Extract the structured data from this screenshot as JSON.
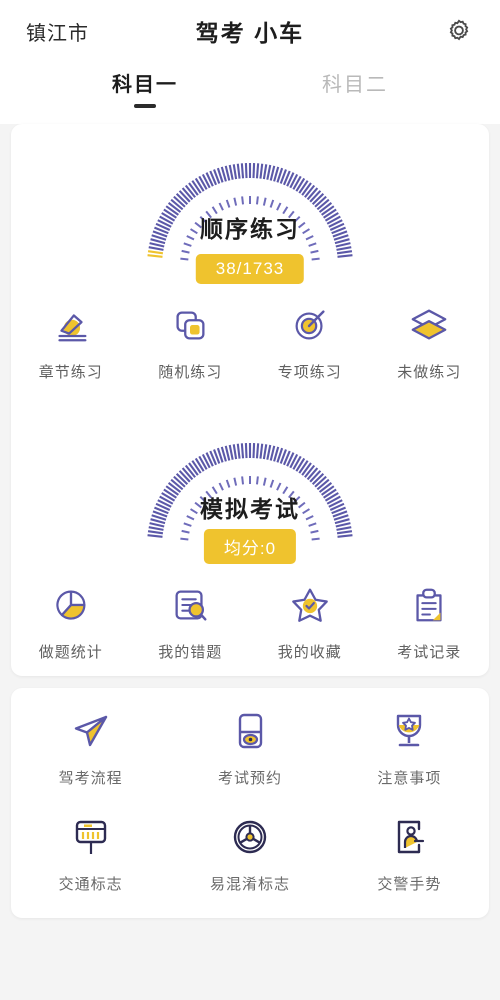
{
  "header": {
    "city": "镇江市",
    "title": "驾考 小车",
    "settings_icon": "gear-icon"
  },
  "tabs": [
    {
      "label": "科目一",
      "active": true
    },
    {
      "label": "科目二",
      "active": false
    }
  ],
  "colors": {
    "purple": "#5b58a8",
    "purple_light": "#6f6cba",
    "yellow": "#efc32e",
    "navy": "#2d2b52",
    "page_bg": "#f4f4f4",
    "card_bg": "#ffffff",
    "label": "#606060",
    "tab_inactive": "#b9b9b9"
  },
  "practice": {
    "gauge": {
      "title": "顺序练习",
      "badge": "38/1733",
      "done": 38,
      "total": 1733
    },
    "items": [
      {
        "label": "章节练习",
        "icon": "pencil-edit-icon"
      },
      {
        "label": "随机练习",
        "icon": "copy-squares-icon"
      },
      {
        "label": "专项练习",
        "icon": "target-icon"
      },
      {
        "label": "未做练习",
        "icon": "layers-stack-icon"
      }
    ]
  },
  "exam": {
    "gauge": {
      "title": "模拟考试",
      "badge": "均分:0",
      "average_score": 0
    },
    "items": [
      {
        "label": "做题统计",
        "icon": "pie-chart-icon"
      },
      {
        "label": "我的错题",
        "icon": "document-search-icon"
      },
      {
        "label": "我的收藏",
        "icon": "star-check-icon"
      },
      {
        "label": "考试记录",
        "icon": "clipboard-icon"
      }
    ]
  },
  "tools": {
    "items": [
      {
        "label": "驾考流程",
        "icon": "paper-plane-icon"
      },
      {
        "label": "考试预约",
        "icon": "booking-card-icon"
      },
      {
        "label": "注意事项",
        "icon": "trophy-star-icon"
      },
      {
        "label": "交通标志",
        "icon": "road-sign-icon"
      },
      {
        "label": "易混淆标志",
        "icon": "steering-wheel-icon"
      },
      {
        "label": "交警手势",
        "icon": "traffic-police-icon"
      }
    ]
  }
}
